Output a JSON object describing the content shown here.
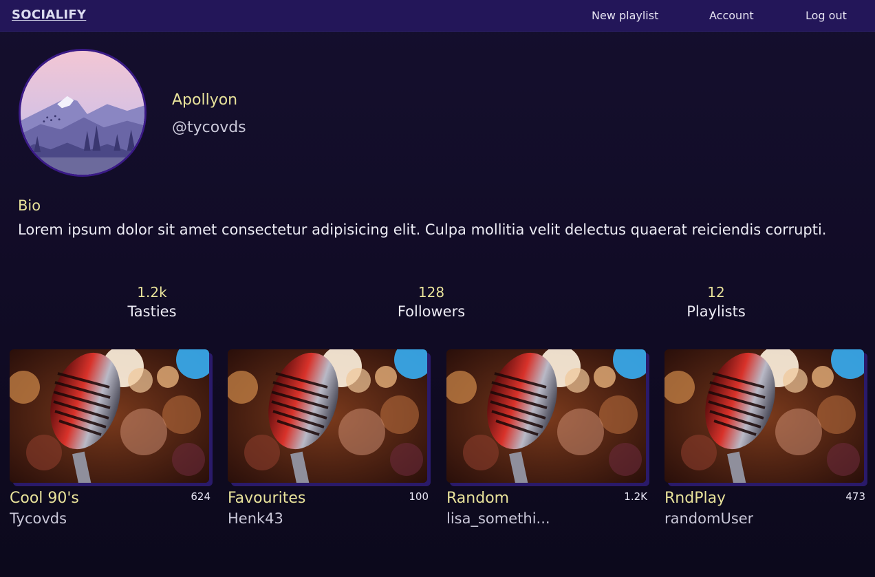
{
  "nav": {
    "brand": "SOCIALIFY",
    "links": [
      "New playlist",
      "Account",
      "Log out"
    ]
  },
  "profile": {
    "display_name": "Apollyon",
    "handle": "@tycovds",
    "avatar_icon": "mountain-landscape-avatar",
    "bio_heading": "Bio",
    "bio_text": "Lorem ipsum dolor sit amet consectetur adipisicing elit. Culpa mollitia velit delectus quaerat reiciendis corrupti."
  },
  "stats": [
    {
      "value": "1.2k",
      "label": "Tasties"
    },
    {
      "value": "128",
      "label": "Followers"
    },
    {
      "value": "12",
      "label": "Playlists"
    }
  ],
  "playlists": [
    {
      "title": "Cool 90's",
      "count": "624",
      "owner": "Tycovds"
    },
    {
      "title": "Favourites",
      "count": "100",
      "owner": "Henk43"
    },
    {
      "title": "Random",
      "count": "1.2K",
      "owner": "lisa_somethi..."
    },
    {
      "title": "RndPlay",
      "count": "473",
      "owner": "randomUser"
    }
  ],
  "colors": {
    "nav_bg": "#231659",
    "page_bg": "#120d28",
    "accent_yellow": "#e8e29a",
    "text": "#ecebf4"
  }
}
